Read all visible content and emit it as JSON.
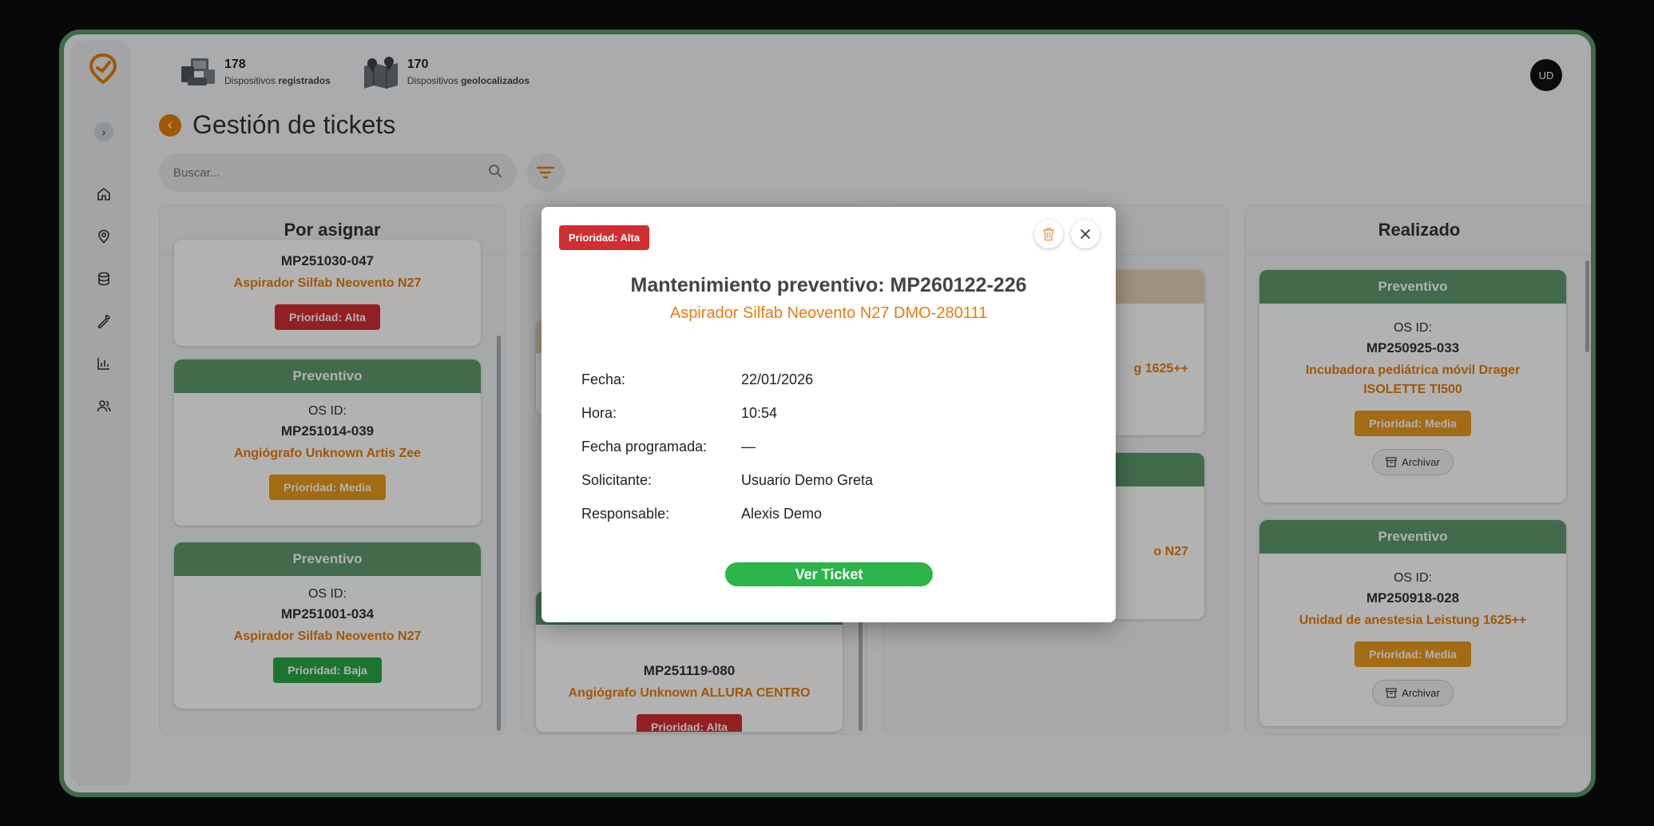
{
  "header": {
    "stats": [
      {
        "value": "178",
        "label_pre": "Dispositivos ",
        "label_bold": "registrados"
      },
      {
        "value": "170",
        "label_pre": "Dispositivos ",
        "label_bold": "geolocalizados"
      }
    ],
    "avatar": "UD",
    "title": "Gestión de tickets",
    "search_placeholder": "Buscar..."
  },
  "columns": [
    {
      "title": "Por asignar",
      "cards": [
        {
          "type": "",
          "label": "",
          "id": "MP251030-047",
          "device": "Aspirador Silfab Neovento N27",
          "priority": "Prioridad: Alta",
          "level": "alta"
        },
        {
          "type": "Preventivo",
          "label": "OS ID:",
          "id": "MP251014-039",
          "device": "Angiógrafo Unknown Artis Zee",
          "priority": "Prioridad: Media",
          "level": "media"
        },
        {
          "type": "Preventivo",
          "label": "OS ID:",
          "id": "MP251001-034",
          "device": "Aspirador Silfab Neovento N27",
          "priority": "Prioridad: Baja",
          "level": "baja"
        }
      ]
    },
    {
      "title": "",
      "cards": [
        {
          "type": "",
          "label": "",
          "id": "MP251119-080",
          "device": "Angiógrafo Unknown ALLURA CENTRO",
          "priority": "Prioridad: Alta",
          "level": "alta"
        }
      ]
    },
    {
      "title": "",
      "cards": [
        {
          "type": "",
          "device_fragment": "g 1625++"
        },
        {
          "type": "",
          "device_fragment": "o N27"
        }
      ]
    },
    {
      "title": "Realizado",
      "cards": [
        {
          "type": "Preventivo",
          "label": "OS ID:",
          "id": "MP250925-033",
          "device": "Incubadora pediátrica móvil Drager ISOLETTE TI500",
          "priority": "Prioridad: Media",
          "level": "media",
          "archive": "Archivar"
        },
        {
          "type": "Preventivo",
          "label": "OS ID:",
          "id": "MP250918-028",
          "device": "Unidad de anestesia Leistung 1625++",
          "priority": "Prioridad: Media",
          "level": "media",
          "archive": "Archivar"
        }
      ]
    }
  ],
  "modal": {
    "priority": "Prioridad: Alta",
    "title": "Mantenimiento preventivo: MP260122-226",
    "subtitle": "Aspirador Silfab Neovento N27 DMO-280111",
    "fields": [
      {
        "label": "Fecha:",
        "value": "22/01/2026"
      },
      {
        "label": "Hora:",
        "value": "10:54"
      },
      {
        "label": "Fecha programada:",
        "value": "—"
      },
      {
        "label": "Solicitante:",
        "value": "Usuario Demo Greta"
      },
      {
        "label": "Responsable:",
        "value": "Alexis Demo"
      }
    ],
    "button": "Ver Ticket"
  },
  "colors": {
    "accent": "#e77d0a",
    "preventivo": "#5e9a6c",
    "alta": "#d12e32",
    "media": "#ea9a1c",
    "baja": "#2aa745",
    "ver_ticket": "#2bb54a"
  },
  "icons": {
    "sidebar": [
      "home-icon",
      "location-pin-icon",
      "database-icon",
      "wrench-icon",
      "bar-chart-icon",
      "users-icon"
    ],
    "search": "search-icon",
    "filter": "filter-icon",
    "trash": "trash-icon",
    "close": "close-icon",
    "archive": "archive-icon"
  }
}
